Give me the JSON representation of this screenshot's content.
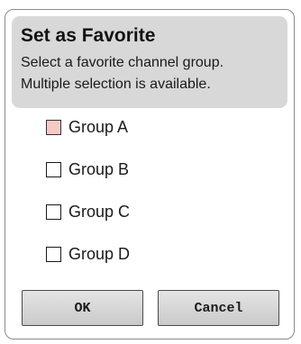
{
  "dialog": {
    "title": "Set as Favorite",
    "description_line1": "Select a favorite channel group.",
    "description_line2": "Multiple selection is available."
  },
  "options": [
    {
      "label": "Group A",
      "checked": false,
      "focused": true
    },
    {
      "label": "Group B",
      "checked": false,
      "focused": false
    },
    {
      "label": "Group C",
      "checked": false,
      "focused": false
    },
    {
      "label": "Group D",
      "checked": false,
      "focused": false
    }
  ],
  "buttons": {
    "ok_label": "OK",
    "cancel_label": "Cancel"
  },
  "colors": {
    "header_bg": "#d8d8d8",
    "focus_highlight": "#f7c9c6",
    "button_bg": "#d4d4d4"
  }
}
